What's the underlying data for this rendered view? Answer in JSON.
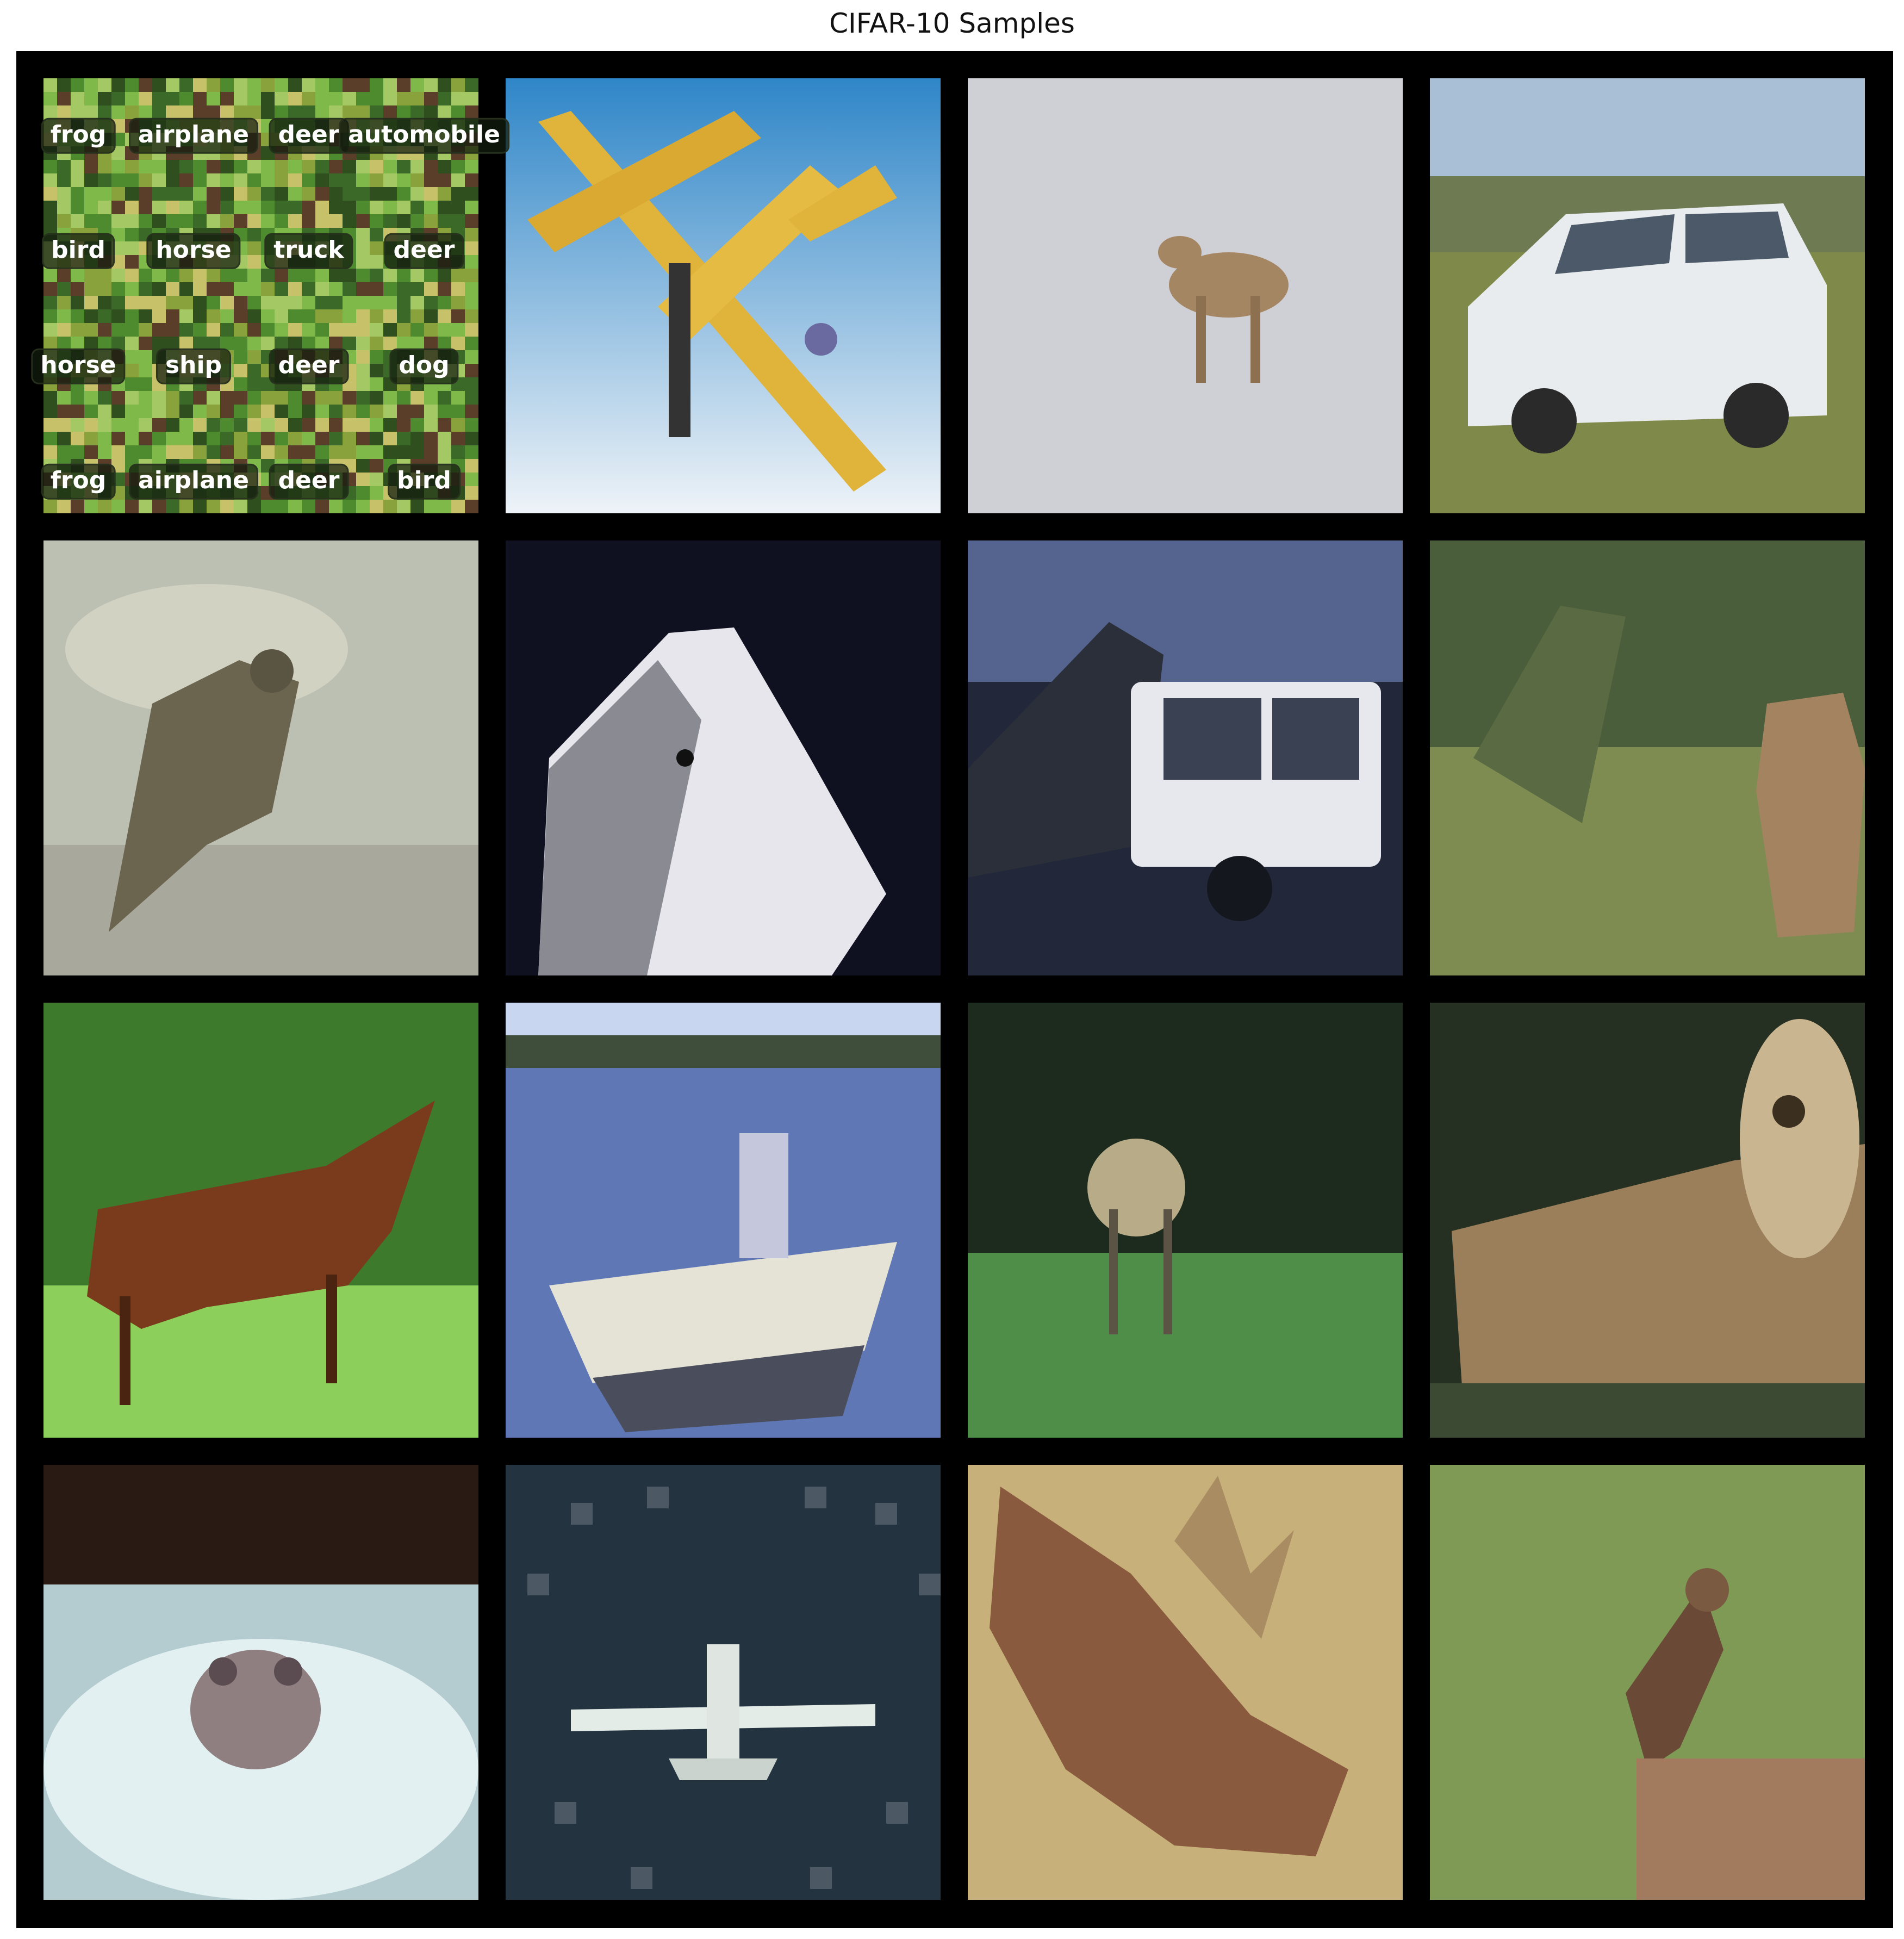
{
  "title": "CIFAR-10 Samples",
  "grid": {
    "rows": 4,
    "cols": 4
  },
  "label_grid": [
    [
      "frog",
      "airplane",
      "deer",
      "automobile"
    ],
    [
      "bird",
      "horse",
      "truck",
      "deer"
    ],
    [
      "horse",
      "ship",
      "deer",
      "dog"
    ],
    [
      "frog",
      "airplane",
      "deer",
      "bird"
    ]
  ],
  "tiles": [
    {
      "subject": "frog-mosaic",
      "bg": "#5f9e3c"
    },
    {
      "subject": "airplane",
      "bg": "#5c9bd0"
    },
    {
      "subject": "deer",
      "bg": "#c9c9cf"
    },
    {
      "subject": "automobile",
      "bg": "#7a8a4c"
    },
    {
      "subject": "bird",
      "bg": "#b9bdb0"
    },
    {
      "subject": "horse",
      "bg": "#0f1020"
    },
    {
      "subject": "truck",
      "bg": "#39405a"
    },
    {
      "subject": "deer",
      "bg": "#4d5e3d"
    },
    {
      "subject": "horse",
      "bg": "#4f8a34"
    },
    {
      "subject": "ship",
      "bg": "#6a80b8"
    },
    {
      "subject": "deer",
      "bg": "#263a25"
    },
    {
      "subject": "dog",
      "bg": "#2f3a2a"
    },
    {
      "subject": "frog",
      "bg": "#9fbcc0"
    },
    {
      "subject": "airplane",
      "bg": "#243340"
    },
    {
      "subject": "deer",
      "bg": "#b7a06a"
    },
    {
      "subject": "bird",
      "bg": "#7f9a55"
    }
  ]
}
